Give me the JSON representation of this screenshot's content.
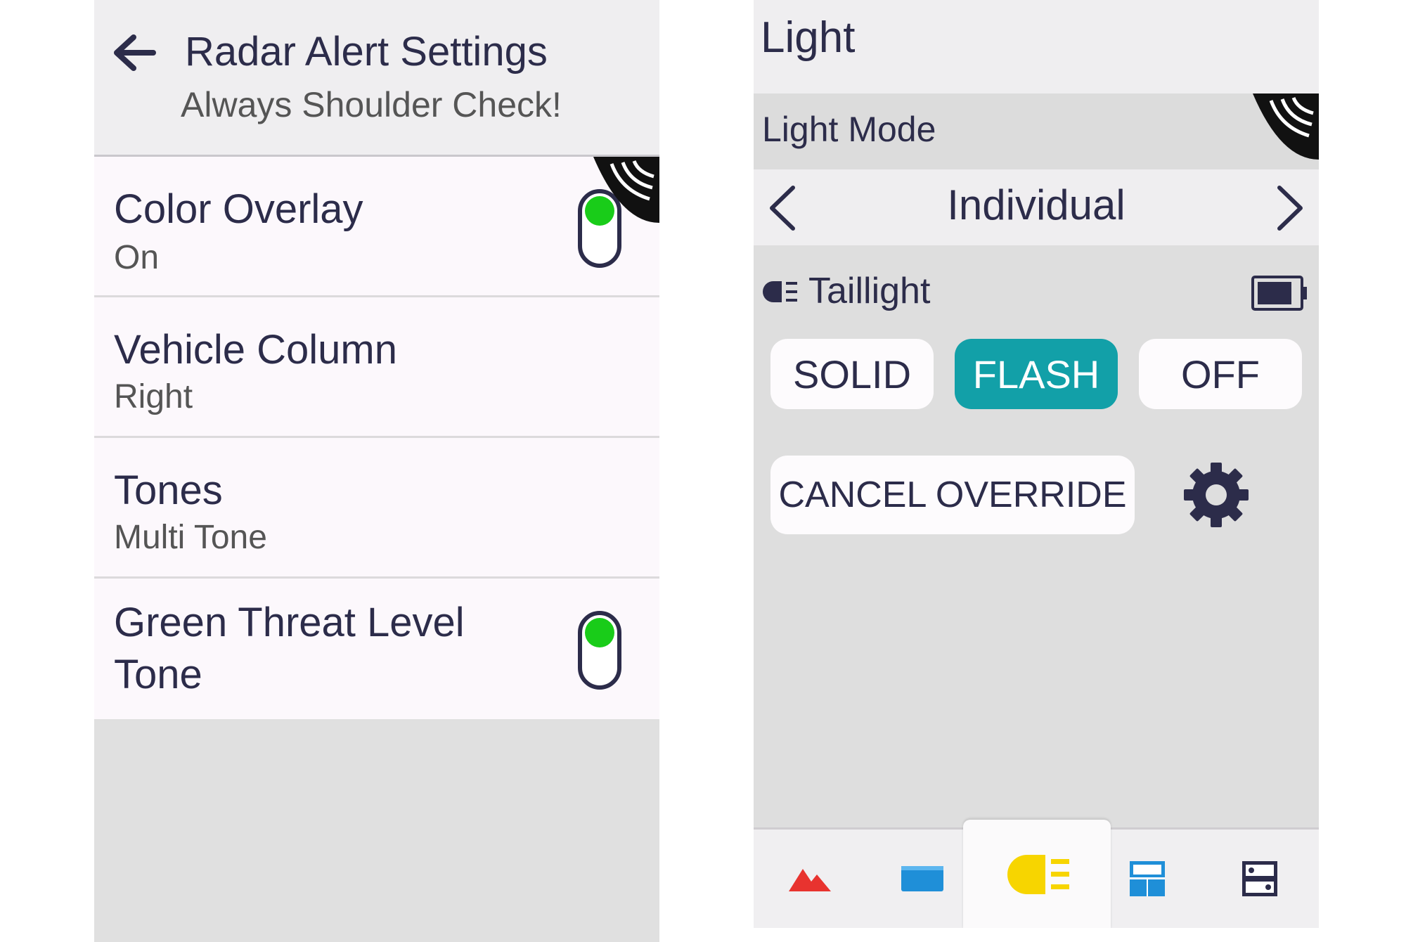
{
  "left_screen": {
    "header": {
      "title": "Radar Alert Settings",
      "subtitle": "Always Shoulder Check!"
    },
    "settings": [
      {
        "title": "Color Overlay",
        "value": "On",
        "toggle_on": true
      },
      {
        "title": "Vehicle Column",
        "value": "Right"
      },
      {
        "title": "Tones",
        "value": "Multi Tone"
      },
      {
        "title_line1": "Green Threat Level",
        "title_line2": "Tone",
        "toggle_on": true
      }
    ]
  },
  "right_screen": {
    "title": "Light",
    "mode_label": "Light Mode",
    "mode_value": "Individual",
    "light_name": "Taillight",
    "buttons": [
      "SOLID",
      "FLASH",
      "OFF"
    ],
    "active_button": "FLASH",
    "cancel_label": "CANCEL OVERRIDE",
    "nav_icons": [
      "radar-mountain-icon",
      "display-bar-icon",
      "headlight-icon",
      "dashboard-layout-icon",
      "device-settings-icon"
    ],
    "active_nav": "headlight-icon"
  },
  "colors": {
    "text_dark": "#2c2c4a",
    "toggle_green": "#19cc19",
    "active_teal": "#12a0a8",
    "nav_red": "#e8332f",
    "nav_blue": "#1f8fd8",
    "nav_yellow": "#f7d500"
  }
}
